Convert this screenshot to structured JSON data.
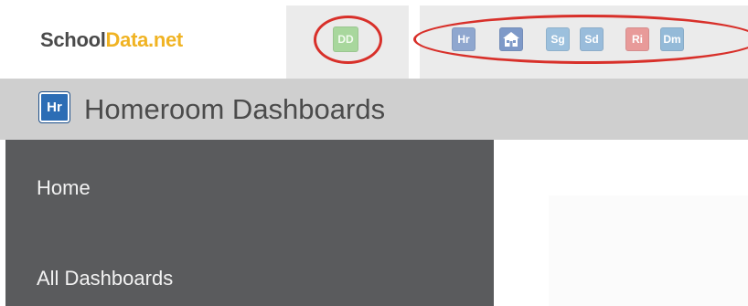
{
  "brand": {
    "logo_part1": "School",
    "logo_part2": "Data.net"
  },
  "app_switcher": {
    "dd": "DD",
    "hr": "Hr",
    "home_icon": "home-icon",
    "sg": "Sg",
    "sd": "Sd",
    "ri": "Ri",
    "dm": "Dm"
  },
  "header": {
    "badge": "Hr",
    "title": "Homeroom Dashboards"
  },
  "sidebar": {
    "items": [
      {
        "label": "Home"
      },
      {
        "label": "All Dashboards"
      }
    ]
  },
  "colors": {
    "logo_dark": "#4a4a4a",
    "logo_accent": "#f0b323",
    "annotation_red": "#d8302a",
    "header_bg": "#cfcfcf",
    "sidebar_bg": "#5a5b5d",
    "hr_badge": "#2c6db5"
  }
}
